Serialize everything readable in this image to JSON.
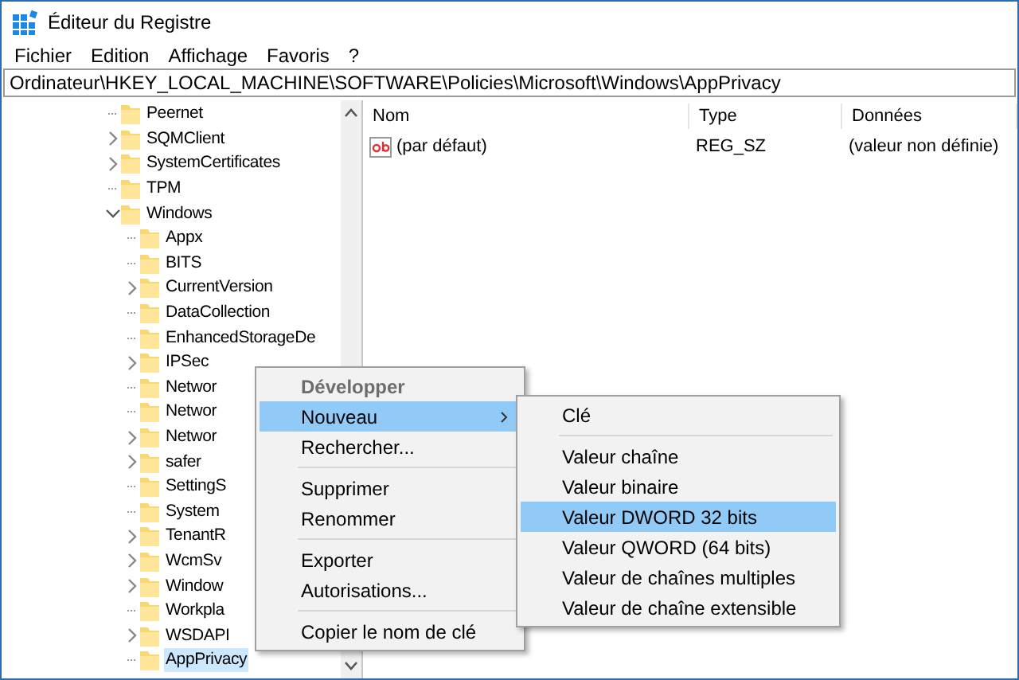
{
  "window": {
    "title": "Éditeur du Registre"
  },
  "menu_bar": [
    "Fichier",
    "Edition",
    "Affichage",
    "Favoris",
    "?"
  ],
  "address": "Ordinateur\\HKEY_LOCAL_MACHINE\\SOFTWARE\\Policies\\Microsoft\\Windows\\AppPrivacy",
  "tree": [
    {
      "label": "Peernet",
      "expandable": false,
      "selected": false
    },
    {
      "label": "SQMClient",
      "expandable": true,
      "expanded": false,
      "selected": false
    },
    {
      "label": "SystemCertificates",
      "expandable": true,
      "expanded": false,
      "selected": false
    },
    {
      "label": "TPM",
      "expandable": false,
      "selected": false
    },
    {
      "label": "Windows",
      "expandable": true,
      "expanded": true,
      "selected": false,
      "children": [
        {
          "label": "Appx",
          "expandable": false,
          "selected": false
        },
        {
          "label": "BITS",
          "expandable": false,
          "selected": false
        },
        {
          "label": "CurrentVersion",
          "expandable": true,
          "expanded": false,
          "selected": false
        },
        {
          "label": "DataCollection",
          "expandable": false,
          "selected": false
        },
        {
          "label": "EnhancedStorageDe",
          "expandable": false,
          "selected": false
        },
        {
          "label": "IPSec",
          "expandable": true,
          "expanded": false,
          "selected": false
        },
        {
          "label": "Networ",
          "expandable": false,
          "selected": false
        },
        {
          "label": "Networ",
          "expandable": false,
          "selected": false
        },
        {
          "label": "Networ",
          "expandable": true,
          "expanded": false,
          "selected": false
        },
        {
          "label": "safer",
          "expandable": true,
          "expanded": false,
          "selected": false
        },
        {
          "label": "SettingS",
          "expandable": false,
          "selected": false
        },
        {
          "label": "System",
          "expandable": false,
          "selected": false
        },
        {
          "label": "TenantR",
          "expandable": true,
          "expanded": false,
          "selected": false
        },
        {
          "label": "WcmSv",
          "expandable": true,
          "expanded": false,
          "selected": false
        },
        {
          "label": "Window",
          "expandable": true,
          "expanded": false,
          "selected": false
        },
        {
          "label": "Workpla",
          "expandable": false,
          "selected": false
        },
        {
          "label": "WSDAPI",
          "expandable": true,
          "expanded": false,
          "selected": false
        },
        {
          "label": "AppPrivacy",
          "expandable": false,
          "selected": true
        }
      ]
    }
  ],
  "values": {
    "columns": [
      "Nom",
      "Type",
      "Données"
    ],
    "rows": [
      {
        "name": "(par défaut)",
        "type": "REG_SZ",
        "data": "(valeur non définie)"
      }
    ]
  },
  "context_menu": {
    "groups": [
      [
        {
          "label": "Développer",
          "bold": true,
          "disabled": true,
          "selected": false,
          "submenu": false
        },
        {
          "label": "Nouveau",
          "bold": false,
          "disabled": false,
          "selected": true,
          "submenu": true
        },
        {
          "label": "Rechercher...",
          "bold": false,
          "disabled": false,
          "selected": false,
          "submenu": false
        }
      ],
      [
        {
          "label": "Supprimer",
          "bold": false,
          "disabled": false,
          "selected": false,
          "submenu": false
        },
        {
          "label": "Renommer",
          "bold": false,
          "disabled": false,
          "selected": false,
          "submenu": false
        }
      ],
      [
        {
          "label": "Exporter",
          "bold": false,
          "disabled": false,
          "selected": false,
          "submenu": false
        },
        {
          "label": "Autorisations...",
          "bold": false,
          "disabled": false,
          "selected": false,
          "submenu": false
        }
      ],
      [
        {
          "label": "Copier le nom de clé",
          "bold": false,
          "disabled": false,
          "selected": false,
          "submenu": false
        }
      ]
    ]
  },
  "submenu": {
    "groups": [
      [
        {
          "label": "Clé",
          "selected": false
        }
      ],
      [
        {
          "label": "Valeur chaîne",
          "selected": false
        },
        {
          "label": "Valeur binaire",
          "selected": false
        },
        {
          "label": "Valeur DWORD 32 bits",
          "selected": true
        },
        {
          "label": "Valeur QWORD (64 bits)",
          "selected": false
        },
        {
          "label": "Valeur de chaînes multiples",
          "selected": false
        },
        {
          "label": "Valeur de chaîne extensible",
          "selected": false
        }
      ]
    ]
  }
}
